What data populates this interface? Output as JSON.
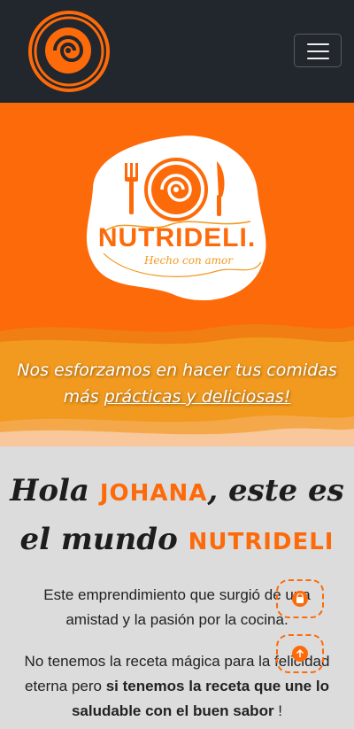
{
  "navbar": {
    "logo": "nutrideli-spiral-logo",
    "toggler": "menu-icon",
    "background": "#22262d"
  },
  "hero": {
    "background": "#fd6a0a",
    "logo": {
      "brand_name": "NUTRIDELI.",
      "slogan": "Hecho con amor"
    },
    "tagline_line1": "Nos esforzamos en hacer tus comidas",
    "tagline_prefix": "más ",
    "tagline_highlight": "prácticas y deliciosas!"
  },
  "content": {
    "heading_part1": "Hola ",
    "heading_name": "JOHANA",
    "heading_part2": ", este es",
    "heading_part3": "el mundo ",
    "heading_brand": "NUTRIDELI",
    "paragraph1": "Este emprendimiento que surgió de una amistad y la pasión por la cocina.",
    "paragraph2_prefix": "No tenemos la receta mágica para la felicidad eterna pero ",
    "paragraph2_bold": "si tenemos la receta que une lo saludable con el buen sabor",
    "paragraph2_suffix": " !"
  },
  "floating_buttons": {
    "cart": "shopping-bag-icon",
    "back_to_top": "arrow-up-icon"
  },
  "colors": {
    "accent": "#fd6a0a",
    "accent_yellow": "#f29a1f",
    "content_bg": "#dcdcdc",
    "text": "#222222"
  }
}
